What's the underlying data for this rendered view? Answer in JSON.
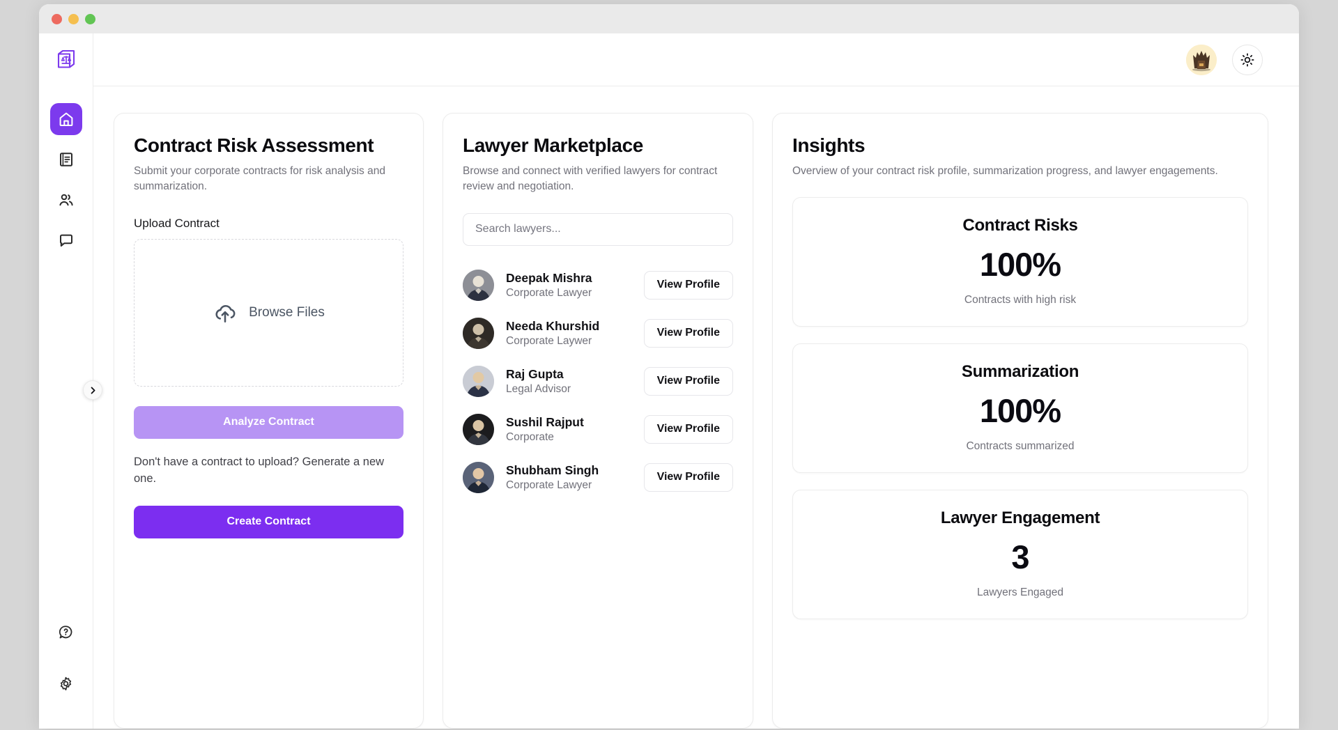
{
  "window": {
    "traffic_lights": [
      "close",
      "minimize",
      "maximize"
    ]
  },
  "sidebar": {
    "logo_icon": "scales-of-justice-book-icon",
    "top_items": [
      {
        "icon": "home-icon",
        "name": "home",
        "active": true
      },
      {
        "icon": "document-icon",
        "name": "contracts",
        "active": false
      },
      {
        "icon": "users-icon",
        "name": "lawyers",
        "active": false
      },
      {
        "icon": "chat-bubble-icon",
        "name": "messages",
        "active": false
      }
    ],
    "bottom_items": [
      {
        "icon": "help-circle-icon",
        "name": "help"
      },
      {
        "icon": "gear-icon",
        "name": "settings"
      }
    ],
    "toggle_icon": "chevron-right-icon"
  },
  "topbar": {
    "avatar_icon": "user-avatar",
    "theme_toggle_icon": "sun-icon"
  },
  "contract_risk": {
    "title": "Contract Risk Assessment",
    "subtitle": "Submit your corporate contracts for risk analysis and summarization.",
    "upload_label": "Upload Contract",
    "dropzone_icon": "cloud-upload-icon",
    "dropzone_label": "Browse Files",
    "analyze_label": "Analyze Contract",
    "hint": "Don't have a contract to upload? Generate a new one.",
    "create_label": "Create Contract",
    "analyze_color": "#b794f4",
    "create_color": "#7c2ef0"
  },
  "marketplace": {
    "title": "Lawyer Marketplace",
    "subtitle": "Browse and connect with verified lawyers for contract review and negotiation.",
    "search_placeholder": "Search lawyers...",
    "search_value": "",
    "view_profile_label": "View Profile",
    "lawyers": [
      {
        "name": "Deepak Mishra",
        "role": "Corporate Lawyer"
      },
      {
        "name": "Needa Khurshid",
        "role": "Corporate Laywer"
      },
      {
        "name": "Raj Gupta",
        "role": "Legal Advisor"
      },
      {
        "name": "Sushil Rajput",
        "role": "Corporate"
      },
      {
        "name": "Shubham Singh",
        "role": "Corporate Lawyer"
      }
    ]
  },
  "insights": {
    "title": "Insights",
    "subtitle": "Overview of your contract risk profile, summarization progress, and lawyer engagements.",
    "stats": [
      {
        "title": "Contract Risks",
        "value": "100%",
        "caption": "Contracts with high risk"
      },
      {
        "title": "Summarization",
        "value": "100%",
        "caption": "Contracts summarized"
      },
      {
        "title": "Lawyer Engagement",
        "value": "3",
        "caption": "Lawyers Engaged"
      }
    ]
  },
  "theme": {
    "accent": "#7c3aed",
    "accent_strong": "#7c2ef0",
    "accent_muted": "#b794f4",
    "page_bg": "#d6d6d6",
    "card_bg": "#ffffff"
  }
}
